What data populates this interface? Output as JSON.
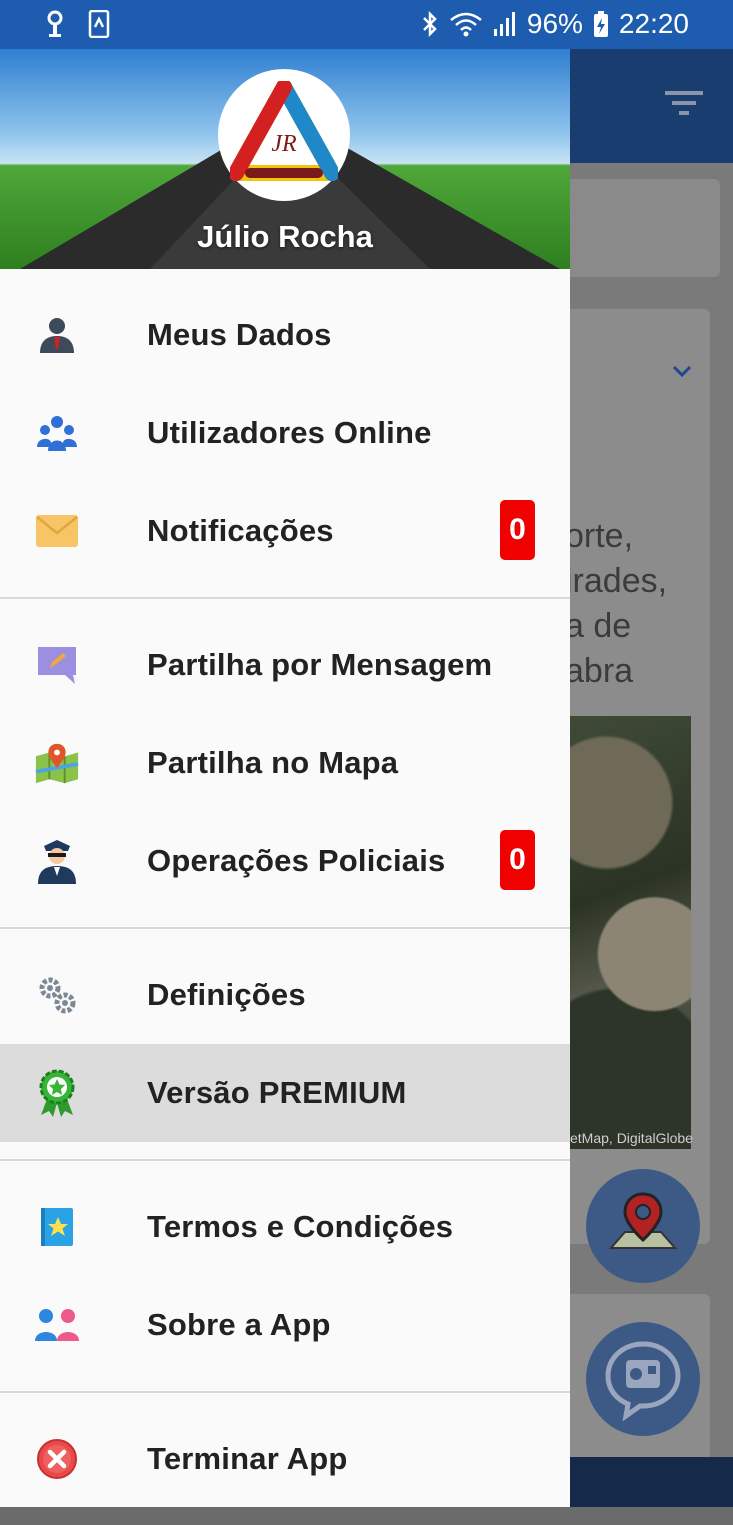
{
  "status_bar": {
    "battery": "96%",
    "time": "22:20"
  },
  "drawer": {
    "user_name": "Júlio Rocha",
    "sections": [
      [
        {
          "label": "Meus Dados",
          "icon": "user-profile-icon"
        },
        {
          "label": "Utilizadores Online",
          "icon": "users-group-icon"
        },
        {
          "label": "Notificações",
          "icon": "envelope-icon",
          "badge": "0"
        }
      ],
      [
        {
          "label": "Partilha por Mensagem",
          "icon": "message-edit-icon"
        },
        {
          "label": "Partilha no Mapa",
          "icon": "map-pin-icon"
        },
        {
          "label": "Operações Policiais",
          "icon": "police-officer-icon",
          "badge": "0"
        }
      ],
      [
        {
          "label": "Definições",
          "icon": "gears-icon"
        },
        {
          "label": "Versão PREMIUM",
          "icon": "premium-badge-icon"
        }
      ],
      [
        {
          "label": "Termos e Condições",
          "icon": "terms-star-icon"
        },
        {
          "label": "Sobre a App",
          "icon": "about-people-icon"
        }
      ],
      [
        {
          "label": "Terminar App",
          "icon": "exit-icon"
        }
      ]
    ]
  },
  "background": {
    "text_lines": [
      "orte,",
      "irades,",
      "a de",
      "abra"
    ],
    "map_credit": "etMap, DigitalGlobe"
  },
  "colors": {
    "status_bar": "#1e5cb0",
    "badge": "#f10000",
    "active_row": "#dcdcdc"
  }
}
